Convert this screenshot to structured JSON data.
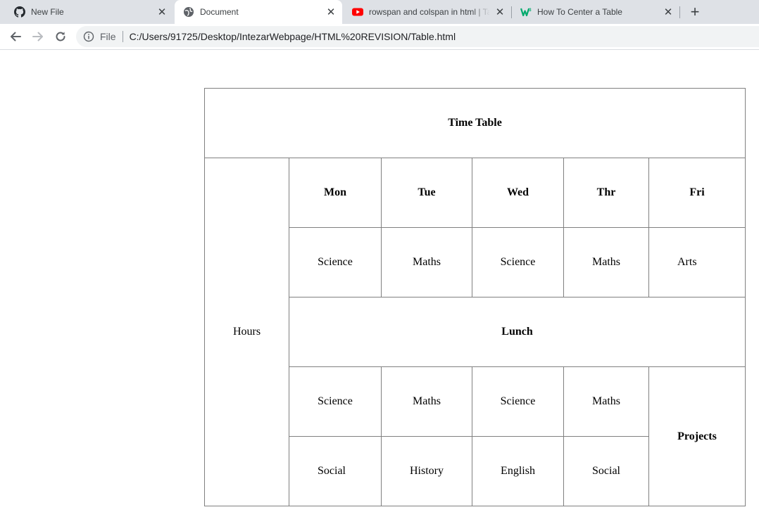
{
  "tabs": [
    {
      "title": "New File",
      "icon": "github-icon",
      "close": "✕"
    },
    {
      "title": "Document",
      "icon": "globe-icon",
      "close": "✕",
      "active": true
    },
    {
      "title": "rowspan and colspan in html | Table",
      "icon": "youtube-icon",
      "close": "✕"
    },
    {
      "title": "How To Center a Table",
      "icon": "w3schools-icon",
      "close": "✕"
    }
  ],
  "new_tab_label": "+",
  "toolbar": {
    "scheme": "File",
    "url": "C:/Users/91725/Desktop/IntezarWebpage/HTML%20REVISION/Table.html"
  },
  "timetable": {
    "title": "Time Table",
    "hours_label": "Hours",
    "days": [
      "Mon",
      "Tue",
      "Wed",
      "Thr",
      "Fri"
    ],
    "row1": [
      "Science",
      "Maths",
      "Science",
      "Maths",
      "Arts"
    ],
    "lunch": "Lunch",
    "row3": [
      "Science",
      "Maths",
      "Science",
      "Maths"
    ],
    "row4": [
      "Social",
      "History",
      "English",
      "Social"
    ],
    "projects": "Projects"
  },
  "colors": {
    "tabstrip_bg": "#dee1e6",
    "active_tab_bg": "#ffffff",
    "omnibox_bg": "#f1f3f4",
    "table_border": "#808080",
    "youtube_red": "#ff0000",
    "w3schools_green": "#04aa6d"
  }
}
